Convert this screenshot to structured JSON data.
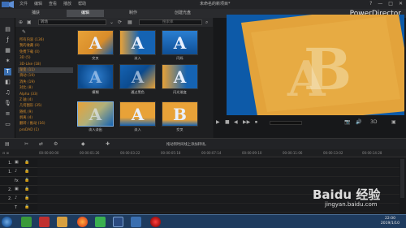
{
  "window": {
    "menu": [
      "文件",
      "编辑",
      "查看",
      "播放",
      "帮助"
    ],
    "title": "未命名的新项目*",
    "controls": [
      "?",
      "—",
      "□",
      "✕"
    ]
  },
  "modes": [
    {
      "label": "捕获",
      "active": false
    },
    {
      "label": "编辑",
      "active": true
    },
    {
      "label": "制作",
      "active": false
    },
    {
      "label": "创建光盘",
      "active": false
    }
  ],
  "brand": "PowerDirector",
  "library": {
    "dropdown_value": "转场",
    "search_placeholder": "搜索库",
    "categories": [
      {
        "label": "所有内容 (136)",
        "selected": false
      },
      {
        "label": "我的收藏 (0)",
        "selected": false
      },
      {
        "label": "免费下载 (0)",
        "selected": false
      },
      {
        "label": "3D (5)",
        "selected": false
      },
      {
        "label": "3D-Like (18)",
        "selected": false
      },
      {
        "label": "渐变 (11)",
        "selected": true
      },
      {
        "label": "滑动 (19)",
        "selected": false
      },
      {
        "label": "消失 (19)",
        "selected": false
      },
      {
        "label": "对比 (8)",
        "selected": false
      },
      {
        "label": "Alpha (33)",
        "selected": false
      },
      {
        "label": "Z 轴 (4)",
        "selected": false
      },
      {
        "label": "几何图形 (35)",
        "selected": false
      },
      {
        "label": "随机 (9)",
        "selected": false
      },
      {
        "label": "剥离 (4)",
        "selected": false
      },
      {
        "label": "翻转 / 推动 (16)",
        "selected": false
      },
      {
        "label": "proDAD (1)",
        "selected": false
      }
    ],
    "thumbnails": [
      {
        "caption": "交叉",
        "selected": false
      },
      {
        "label": "",
        "caption": "淡入",
        "selected": false
      },
      {
        "caption": "闪烁",
        "selected": false
      },
      {
        "caption": "模糊",
        "selected": false
      },
      {
        "caption": "通过黑色",
        "selected": false
      },
      {
        "caption": "闪光渐变",
        "selected": false
      },
      {
        "caption": "淡入淡出",
        "selected": true
      },
      {
        "caption": "淡入",
        "selected": false
      },
      {
        "caption": "交叉",
        "selected": false
      }
    ]
  },
  "preview": {
    "letter": "B",
    "controls": [
      "▶",
      "■",
      "◀",
      "▶▶",
      "⏹",
      "📷",
      "🔊",
      "3D",
      "▣"
    ]
  },
  "timeline": {
    "hint": "拖动到时间线上添加转场。",
    "ticks": [
      "00:00:00:00",
      "00:00:01:26",
      "00:00:03:22",
      "00:00:05:18",
      "00:00:07:14",
      "00:00:09:10",
      "00:00:11:06",
      "00:00:13:02",
      "00:00:14:28"
    ],
    "tracks": [
      "1.",
      "1.",
      "fx",
      "2.",
      "2.",
      "T"
    ]
  },
  "taskbar": {
    "time": "22:00",
    "date": "2019/1/10"
  },
  "watermark": {
    "text": "Baidu 经验",
    "url": "jingyan.baidu.com"
  },
  "colors": {
    "accent": "#3a6fb0",
    "category_text": "#d08a2c",
    "thumb_blue": "#0d5aa8",
    "thumb_orange": "#e8a238"
  }
}
